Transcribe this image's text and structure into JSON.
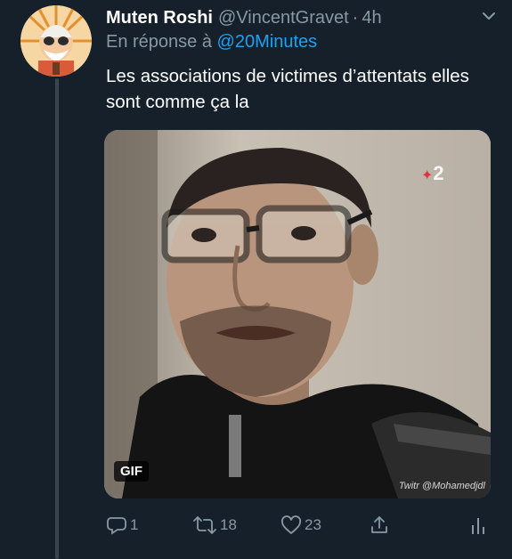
{
  "tweet": {
    "display_name": "Muten Roshi",
    "handle": "@VincentGravet",
    "separator": "·",
    "time": "4h",
    "reply_prefix": "En réponse à",
    "reply_to": "@20Minutes",
    "text": "Les associations de victimes d’attentats elles sont comme ça la"
  },
  "media": {
    "badge": "GIF",
    "channel_logo": "2",
    "watermark": "Twitr @Mohamedjdl"
  },
  "actions": {
    "replies": "1",
    "retweets": "18",
    "likes": "23"
  },
  "icons": {
    "more": "chevron-down-icon",
    "reply": "reply-icon",
    "retweet": "retweet-icon",
    "like": "heart-icon",
    "share": "share-icon",
    "analytics": "analytics-icon"
  },
  "colors": {
    "background": "#15202b",
    "secondary_text": "#8899a6",
    "link": "#1da1f2",
    "thread_line": "#38444d"
  }
}
